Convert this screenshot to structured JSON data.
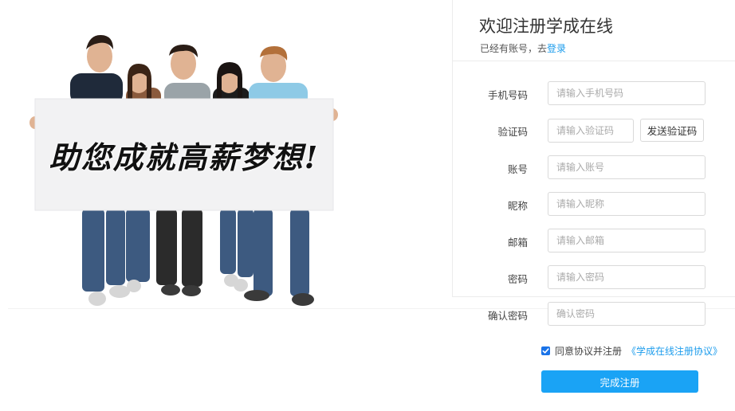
{
  "illustration": {
    "banner_text": "助您成就高薪梦想!"
  },
  "header": {
    "title": "欢迎注册学成在线",
    "have_account_text": "已经有账号，去",
    "login_link": "登录"
  },
  "form": {
    "phone": {
      "label": "手机号码",
      "placeholder": "请输入手机号码",
      "value": ""
    },
    "code": {
      "label": "验证码",
      "placeholder": "请输入验证码",
      "value": "",
      "send_button": "发送验证码"
    },
    "account": {
      "label": "账号",
      "placeholder": "请输入账号",
      "value": ""
    },
    "nickname": {
      "label": "昵称",
      "placeholder": "请输入昵称",
      "value": ""
    },
    "email": {
      "label": "邮箱",
      "placeholder": "请输入邮箱",
      "value": ""
    },
    "password": {
      "label": "密码",
      "placeholder": "请输入密码",
      "value": ""
    },
    "confirm_password": {
      "label": "确认密码",
      "placeholder": "确认密码",
      "value": ""
    },
    "agreement": {
      "checked": true,
      "text": "同意协议并注册",
      "link": "《学成在线注册协议》"
    },
    "submit_label": "完成注册"
  },
  "colors": {
    "accent": "#1aa3f5",
    "link": "#1c9cec",
    "checkbox": "#1a73e8"
  }
}
